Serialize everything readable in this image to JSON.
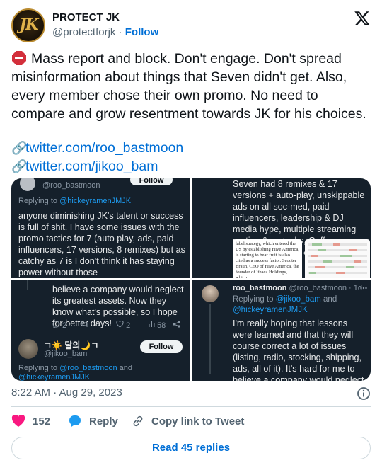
{
  "author": {
    "name": "PROTECT JK",
    "handle": "@protectforjk",
    "follow_label": "Follow",
    "avatar_text": "JK"
  },
  "tweet": {
    "text": "Mass report and block. Don't engage. Don't spread misinformation about things that Seven didn't get. Also, every member chose their own promo. No need to compare and grow resentment towards JK for his choices.",
    "links": [
      "twitter.com/roo_bastmoon",
      "twitter.com/jikoo_bam"
    ]
  },
  "media": {
    "tile1": {
      "handle": "@roo_bastmoon",
      "follow": "Follow",
      "replying_prefix": "Replying to ",
      "replying_to": "@hickeyramenJMJK",
      "text": "anyone diminishing JK's talent or success is full of shit. I have some issues with the promo tactics for 7 (auto play, ads, paid influencers, 17 versions, 8 remixes) but as catchy as 7 is I don't think it has staying power without those"
    },
    "tile2": {
      "text": "Seven had 8 remixes & 17 versions + auto-play, unskippable ads on all soc-med, paid influencers, leadership & DJ media hype, multiple streaming parties & restocks, Geffen purchase tutorial, & more...",
      "article": "label strategy, which entered the US by establishing Hive America, is starting to bear fruit is also cited as a success factor. Scooter Braun, CEO of Hive America, the founder of Ithaca Holdings, which"
    },
    "tile3": {
      "text_top": "believe a company would neglect its greatest assets. Now they know what's possible, so I hope for better days!",
      "stats": [
        "2",
        "2",
        "58"
      ],
      "display_name": "ㄱ☀️ 달의🌙ㄱ",
      "handle": "@jikoo_bam",
      "follow": "Follow",
      "replying_prefix": "Replying to ",
      "replying_to": "@roo_bastmoon",
      "and": " and",
      "replying_to2": "@hickeyramenJMJK"
    },
    "tile4": {
      "name": "roo_bastmoon",
      "handle": "@roo_bastmoon · 1d",
      "replying_prefix": "Replying to ",
      "replying_to": "@jikoo_bam",
      "and": " and",
      "replying_to2": "@hickeyramenJMJK",
      "text": "I'm really hoping that lessons were learned and that they will course correct a lot of issues (listing, radio, stocking, shipping, ads, all of it). It's hard for me to believe a company would neglect its greatest assets. Now they know what's possible, so I hope for better days!"
    }
  },
  "meta": {
    "timestamp": "8:22 AM · Aug 29, 2023",
    "likes": "152",
    "reply_label": "Reply",
    "copy_label": "Copy link to Tweet",
    "read_replies": "Read 45 replies"
  },
  "colors": {
    "link": "#006fd6",
    "like": "#f91880",
    "reply_bubble": "#1d9bf0",
    "dark_tile": "#15202b"
  }
}
